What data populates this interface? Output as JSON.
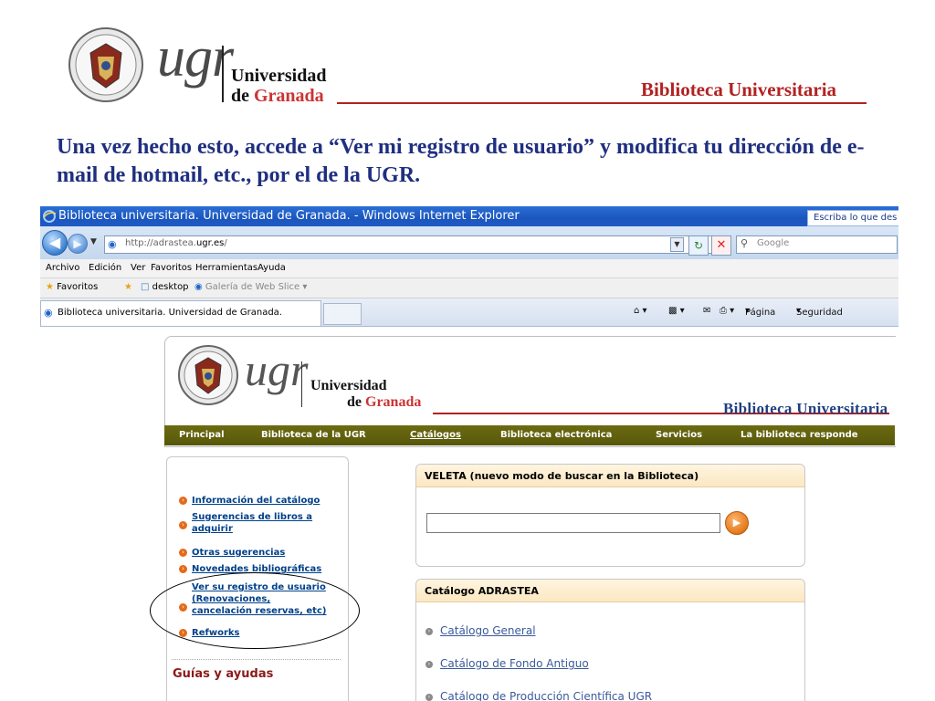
{
  "slide": {
    "logo_word": "ugr",
    "university_line1": "Universidad",
    "university_de": "de",
    "university_granada": "Granada",
    "library": "Biblioteca Universitaria",
    "instruction": "Una vez hecho esto, accede a “Ver mi registro de usuario” y modifica tu dirección de e-mail de hotmail, etc., por el de la UGR."
  },
  "browser": {
    "window_title": "Biblioteca universitaria. Universidad de Granada. - Windows Internet Explorer",
    "search_hint": "Escriba lo que des",
    "url_prefix": "http://adrastea.",
    "url_host": "ugr.es",
    "url_suffix": "/",
    "search_placeholder": "Google",
    "menu": [
      "Archivo",
      "Edición",
      "Ver",
      "Favoritos",
      "Herramientas",
      "Ayuda"
    ],
    "favorites_label": "Favoritos",
    "fav_desktop": "desktop",
    "fav_gallery": "Galería de Web Slice",
    "tab_title": "Biblioteca universitaria. Universidad de Granada.",
    "cmd_page": "Página",
    "cmd_security": "Seguridad"
  },
  "site": {
    "logo_word": "ugr",
    "university_line1": "Universidad",
    "university_de": "de",
    "university_granada": "Granada",
    "library": "Biblioteca Universitaria",
    "nav": [
      "Principal",
      "Biblioteca de la UGR",
      "Catálogos",
      "Biblioteca electrónica",
      "Servicios",
      "La biblioteca responde"
    ],
    "left_links": [
      "Información del catálogo",
      "Sugerencias de libros a",
      "adquirir",
      "Otras sugerencias",
      "Novedades bibliográficas",
      "Ver su registro de usuario",
      "(Renovaciones,",
      "cancelación reservas, etc)",
      "Refworks"
    ],
    "guides_heading": "Guías y ayudas",
    "veleta_header": "VELETA (nuevo modo de buscar en la Biblioteca)",
    "adrastea_header": "Catálogo ADRASTEA",
    "catalogs": [
      "Catálogo General",
      "Catálogo de Fondo Antiguo",
      "Catálogo de Producción Científica UGR"
    ]
  },
  "colors": {
    "instruction": "#1f2f80",
    "accent_red": "#b22222",
    "nav_olive": "#57570a",
    "link_blue": "#00408a",
    "bullet_orange": "#e56a1a"
  }
}
